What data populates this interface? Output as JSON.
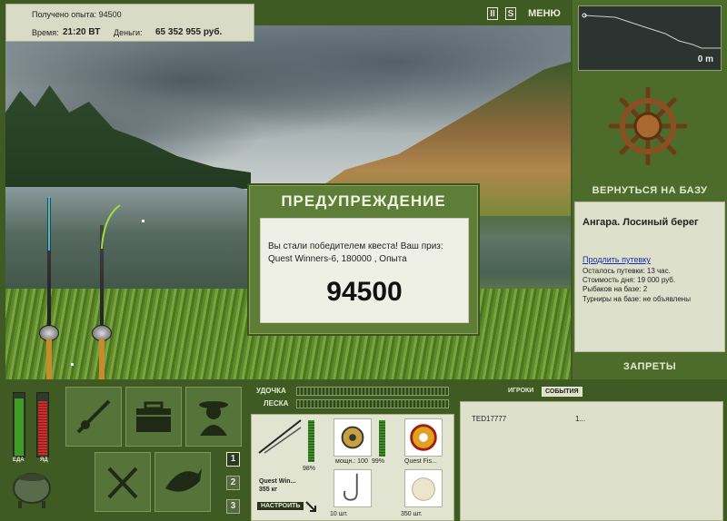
{
  "info": {
    "experience_label": "Получено опыта: 94500",
    "time_label": "Время:",
    "time_value": "21:20 ВТ",
    "money_label": "Деньги:",
    "money_value": "65 352 955 руб."
  },
  "controls": {
    "pause": "II",
    "sound": "S",
    "menu": "МЕНЮ"
  },
  "minimap": {
    "distance": "0 m"
  },
  "right": {
    "back_button": "ВЕРНУТЬСЯ НА БАЗУ",
    "location": "Ангара. Лосиный берег",
    "extend_link": "Продлить путевку",
    "lines": [
      "Осталось путевки: 13 час.",
      "Стоимость дня: 19 000 руб.",
      "Рыбаков на базе: 2",
      "Турниры на базе: не объявлены"
    ],
    "bans_button": "ЗАПРЕТЫ"
  },
  "dialog": {
    "title": "ПРЕДУПРЕЖДЕНИЕ",
    "message": "Вы стали победителем квеста! Ваш приз: Quest Winners-6, 180000 , Опыта",
    "amount": "94500"
  },
  "gauges": {
    "food_label": "ЕДА",
    "poison_label": "ЯД",
    "food_level": 0.92,
    "poison_level": 0.88
  },
  "numbers": [
    "1",
    "2",
    "3"
  ],
  "bars": {
    "rod_label": "УДОЧКА",
    "line_label": "ЛЕСКА"
  },
  "tackle": {
    "rod_name": "Quest Win...",
    "rod_weight": "355 кг",
    "rod_percent": "98%",
    "setup_button": "НАСТРОИТЬ",
    "reel_caption": "мощн.: 100",
    "reel_percent": "99%",
    "line_caption": "Quest Fis...",
    "hook_caption": "10 шт.",
    "bait_caption": "350 шт."
  },
  "tabs": {
    "players": "ИГРОКИ",
    "events": "СОБЫТИЯ"
  },
  "events": {
    "player": "TED17777",
    "value": "1..."
  },
  "colors": {
    "panel_green": "#4d6b2b",
    "light_panel": "#dde0cb",
    "dialog_green": "#5e7d36",
    "link_blue": "#1a2aa8",
    "gauge_green": "#3f9a2a",
    "gauge_red": "#c8302a"
  }
}
